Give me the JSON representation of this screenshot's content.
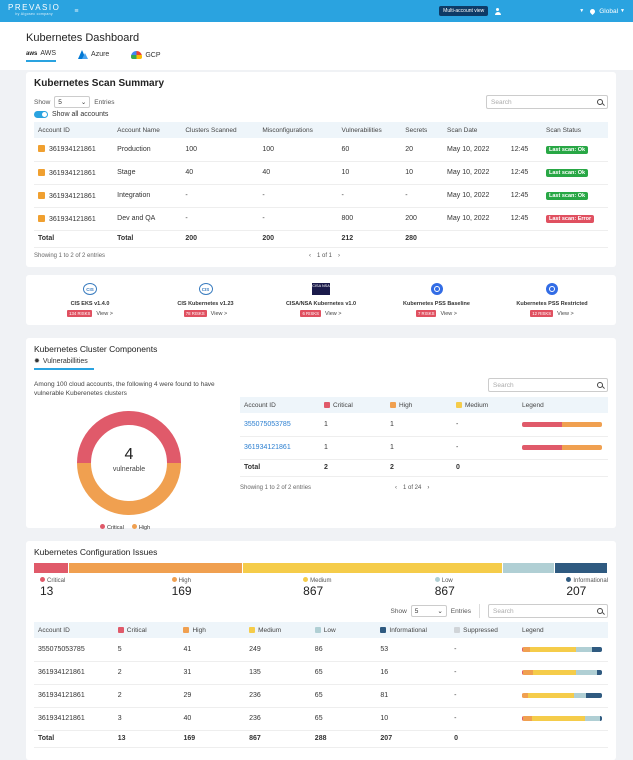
{
  "topbar": {
    "brand": "PREVASIO",
    "brand_sub": "by Algosec company",
    "multi_account": "Multi-account view",
    "global": "Global"
  },
  "dashboard": {
    "title": "Kubernetes Dashboard",
    "tabs": [
      {
        "logo": "aws",
        "label": "AWS"
      },
      {
        "logo": "Azure-logo",
        "label": "Azure"
      },
      {
        "logo": "GCP-logo",
        "label": "GCP"
      }
    ]
  },
  "scan_summary": {
    "title": "Kubernetes Scan Summary",
    "show_label": "Show",
    "show_value": "5",
    "entries_label": "Entries",
    "search_placeholder": "Search",
    "show_all": "Show all accounts",
    "columns": [
      "Account ID",
      "Account Name",
      "Clusters Scanned",
      "Misconfigurations",
      "Vulnerabilities",
      "Secrets",
      "Scan Date",
      "",
      "Scan Status"
    ],
    "rows": [
      {
        "id": "361934121861",
        "name": "Production",
        "clusters": "100",
        "misconf": "100",
        "vulns": "60",
        "secrets": "20",
        "date": "May 10, 2022",
        "time": "12:45",
        "status": "Last scan: Ok",
        "status_color": "#28a745"
      },
      {
        "id": "361934121861",
        "name": "Stage",
        "clusters": "40",
        "misconf": "40",
        "vulns": "10",
        "secrets": "10",
        "date": "May 10, 2022",
        "time": "12:45",
        "status": "Last scan: Ok",
        "status_color": "#28a745"
      },
      {
        "id": "361934121861",
        "name": "Integration",
        "clusters": "-",
        "misconf": "-",
        "vulns": "-",
        "secrets": "-",
        "date": "May 10, 2022",
        "time": "12:45",
        "status": "Last scan: Ok",
        "status_color": "#28a745"
      },
      {
        "id": "361934121861",
        "name": "Dev and QA",
        "clusters": "-",
        "misconf": "-",
        "vulns": "800",
        "secrets": "200",
        "date": "May 10, 2022",
        "time": "12:45",
        "status": "Last scan: Error",
        "status_color": "#e05060"
      }
    ],
    "total": {
      "label": "Total",
      "name": "Total",
      "clusters": "200",
      "misconf": "200",
      "vulns": "212",
      "secrets": "280"
    },
    "footer": "Showing 1 to 2 of 2 entries",
    "pager": "1 of 1"
  },
  "frameworks": [
    {
      "logo": "CIS",
      "name": "CIS EKS v1.4.0",
      "risks": "134 RISKS",
      "view": "View >"
    },
    {
      "logo": "CIS",
      "name": "CIS Kubernetes v1.23",
      "risks": "78 RISKS",
      "view": "View >"
    },
    {
      "logo": "CISA NSA",
      "name": "CISA/NSA Kubernetes v1.0",
      "risks": "6 RISKS",
      "view": "View >"
    },
    {
      "logo": "k8s",
      "name": "Kubernetes PSS Baseline",
      "risks": "7 RISKS",
      "view": "View >"
    },
    {
      "logo": "k8s",
      "name": "Kubernetes PSS Restricted",
      "risks": "12 RISKS",
      "view": "View >"
    }
  ],
  "components": {
    "title": "Kubernetes Cluster Components",
    "tab": "Vulnerabillities",
    "description": "Among 100 cloud accounts, the following 4 were found to have vulnerable Kuberenetes clusters",
    "search_placeholder": "Search",
    "donut_value": "4",
    "donut_label": "vulnerable",
    "donut_legend": [
      {
        "name": "Critical",
        "color": "#e05a6a"
      },
      {
        "name": "High",
        "color": "#f0a050"
      }
    ],
    "columns": [
      "Account ID",
      "Critical",
      "High",
      "Medium",
      "Legend"
    ],
    "rows": [
      {
        "id": "355075053785",
        "critical": "1",
        "high": "1",
        "medium": "-"
      },
      {
        "id": "361934121861",
        "critical": "1",
        "high": "1",
        "medium": "-"
      }
    ],
    "total": {
      "label": "Total",
      "critical": "2",
      "high": "2",
      "medium": "0"
    },
    "footer": "Showing 1 to 2 of 2 entries",
    "pager": "1 of 24",
    "chart_data": {
      "type": "pie",
      "categories": [
        "Critical",
        "High"
      ],
      "values": [
        2,
        2
      ],
      "colors": [
        "#e05a6a",
        "#f0a050"
      ],
      "center_value": "4",
      "center_label": "vulnerable"
    }
  },
  "config": {
    "title": "Kubernetes Configuration Issues",
    "severities": [
      {
        "name": "Critical",
        "value": "13",
        "color": "#e05a6a"
      },
      {
        "name": "High",
        "value": "169",
        "color": "#f0a050"
      },
      {
        "name": "Medium",
        "value": "867",
        "color": "#f5cc4a"
      },
      {
        "name": "Low",
        "value": "867",
        "color": "#b0cfd4"
      },
      {
        "name": "Informational",
        "value": "207",
        "color": "#2f5a80"
      }
    ],
    "show_label": "Show",
    "show_value": "5",
    "entries_label": "Entries",
    "search_placeholder": "Search",
    "columns": [
      "Account ID",
      "Critical",
      "High",
      "Medium",
      "Low",
      "Informational",
      "Suppressed",
      "Legend"
    ],
    "column_colors": [
      "",
      "#e05a6a",
      "#f0a050",
      "#f5cc4a",
      "#b0cfd4",
      "#2f5a80",
      "#d0d4d8",
      ""
    ],
    "rows": [
      {
        "id": "355075053785",
        "critical": "5",
        "high": "41",
        "medium": "249",
        "low": "86",
        "info": "53",
        "supp": "-"
      },
      {
        "id": "361934121861",
        "critical": "2",
        "high": "31",
        "medium": "135",
        "low": "65",
        "info": "16",
        "supp": "-"
      },
      {
        "id": "361934121861",
        "critical": "2",
        "high": "29",
        "medium": "236",
        "low": "65",
        "info": "81",
        "supp": "-"
      },
      {
        "id": "361934121861",
        "critical": "3",
        "high": "40",
        "medium": "236",
        "low": "65",
        "info": "10",
        "supp": "-"
      }
    ],
    "total": {
      "label": "Total",
      "critical": "13",
      "high": "169",
      "medium": "867",
      "low": "288",
      "info": "207",
      "supp": "0"
    },
    "chart_data": {
      "type": "bar",
      "categories": [
        "Critical",
        "High",
        "Medium",
        "Low",
        "Informational"
      ],
      "values": [
        13,
        169,
        867,
        288,
        207
      ]
    }
  }
}
